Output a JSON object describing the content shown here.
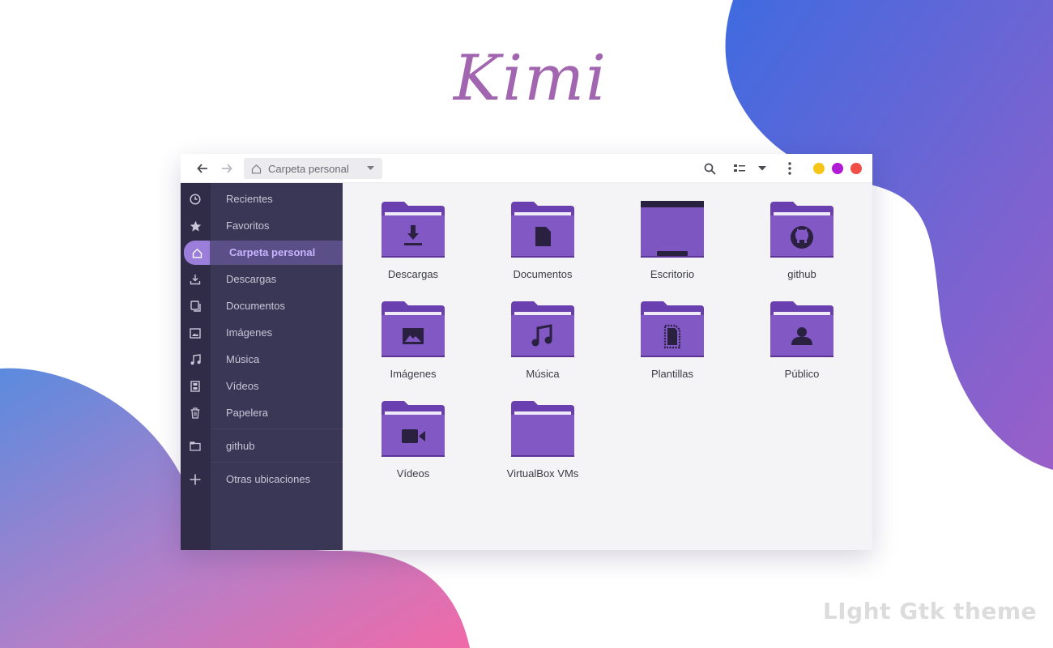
{
  "brand": {
    "logo_text": "Kimi",
    "tagline": "LIght Gtk theme"
  },
  "colors": {
    "accent": "#7d58c4",
    "folder_tab": "#6a3fb0",
    "folder_body": "#8158c4",
    "sidebar_bg": "#3a3655",
    "dot_yellow": "#f5c518",
    "dot_purple": "#b11bd6",
    "dot_red": "#ef4f47"
  },
  "headerbar": {
    "back_icon": "arrow-left-icon",
    "forward_icon": "arrow-right-icon",
    "path_label": "Carpeta personal",
    "search_icon": "search-icon",
    "view_icon": "list-view-icon",
    "menu_icon": "kebab-menu-icon"
  },
  "sidebar": {
    "items": [
      {
        "label": "Recientes",
        "icon": "clock-icon"
      },
      {
        "label": "Favoritos",
        "icon": "star-icon"
      },
      {
        "label": "Carpeta personal",
        "icon": "home-icon",
        "active": true
      },
      {
        "label": "Descargas",
        "icon": "download-icon"
      },
      {
        "label": "Documentos",
        "icon": "document-icon"
      },
      {
        "label": "Imágenes",
        "icon": "image-icon"
      },
      {
        "label": "Música",
        "icon": "music-icon"
      },
      {
        "label": "Vídeos",
        "icon": "film-icon"
      },
      {
        "label": "Papelera",
        "icon": "trash-icon"
      },
      {
        "label": "github",
        "icon": "folder-icon"
      },
      {
        "label": "Otras ubicaciones",
        "icon": "plus-icon"
      }
    ]
  },
  "files": [
    {
      "name": "Descargas",
      "icon": "download-icon"
    },
    {
      "name": "Documentos",
      "icon": "document-icon"
    },
    {
      "name": "Escritorio",
      "icon": "desktop-icon"
    },
    {
      "name": "github",
      "icon": "github-icon"
    },
    {
      "name": "Imágenes",
      "icon": "image-icon"
    },
    {
      "name": "Música",
      "icon": "music-icon"
    },
    {
      "name": "Plantillas",
      "icon": "template-icon"
    },
    {
      "name": "Público",
      "icon": "user-icon"
    },
    {
      "name": "Vídeos",
      "icon": "video-camera-icon"
    },
    {
      "name": "VirtualBox VMs",
      "icon": "folder-icon"
    }
  ]
}
